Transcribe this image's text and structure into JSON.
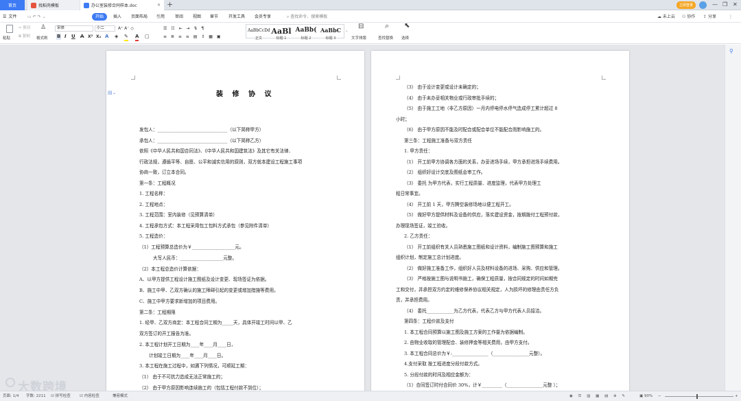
{
  "titlebar": {
    "home_tab": "首页",
    "tabs": [
      {
        "label": "找稻壳模板"
      },
      {
        "label": "办公室装修合同样本.doc"
      }
    ],
    "new_tab": "+",
    "user_button": "立即登录"
  },
  "menubar": {
    "file": "文件",
    "items": [
      "开始",
      "插入",
      "页面布局",
      "引用",
      "审阅",
      "视图",
      "章节",
      "开发工具",
      "会员专享"
    ],
    "active": "开始",
    "search_placeholder": "查找命令、搜索模板",
    "cloud": "未上云",
    "collab": "协作",
    "share": "分享"
  },
  "ribbon": {
    "paste": "粘贴",
    "cut": "剪切",
    "copy": "复制",
    "format_painter": "格式刷",
    "font_name": "宋体",
    "font_size": "小二",
    "styles": [
      {
        "preview": "AaBbCcDd",
        "label": "正文"
      },
      {
        "preview": "AaBl",
        "label": "标题 1"
      },
      {
        "preview": "AaBb(",
        "label": "标题 2"
      },
      {
        "preview": "AaBbC",
        "label": "标题 3"
      }
    ],
    "text_layout": "文字排版",
    "find_replace": "查找替换",
    "select": "选择"
  },
  "page1": {
    "title": "装 修 协 议",
    "lines": [
      "发包人：_______________________________（以下简称甲方）",
      "承包人：_______________________________（以下简称乙方）",
      "依照《中华人民共和国合同法》、《中华人民共和国建筑法》及其它有关法律、",
      "行政法规，遵循平等、自愿、公平和诚实信用的原则，双方就本建设工程施工事项",
      "协商一致，订立本合同。",
      "第一条：工程概况",
      "1. 工程名称：",
      "2. 工程地点：",
      "3. 工程范围：室内装修（见预算清单）",
      "4. 工程承包方式：本工程采用包工包料方式承包（参见附件清单）",
      "5. 工程造价：",
      "（1）工程预算总造价为￥___________________元。",
      "大写人民币：___________________元整。",
      "（2）本工程总造价计算依据：",
      "A、以甲方提供工程设计施工图纸及设计变更、现场签证为依据。",
      "B、施工中甲、乙双方确认的施工障碍引起的变更或增加措施等费用。",
      "C、施工中甲方要求新增加的项目费用。",
      "第二条：工程期限",
      "1. 经甲、乙双方商定：本工程合同工期为_____天，具体开竣工时间以甲、乙",
      "双方签订的开工报告为准。",
      "2. 本工程计划开工日期为____年____月____日，",
      "计划竣工日期为____年____月____日。",
      "3. 本工程在施工过程中，如遇下列情况，可顺延工期：",
      "（1） 由于不可抗力造成无法正常施工的；",
      "（2） 由于甲方原因影响连续施工的（包括工程付款不到位）；"
    ]
  },
  "page2": {
    "lines": [
      "（3） 由于设计变更或设计未确定的；",
      "（4） 由于未办妥相关物业或行政审批手续的；",
      "（5） 由于施工工地（非乙方原因）一月内停电停水停气造成停工累计超过 8",
      "小时；",
      "（6） 由于甲方原因不能及时配合或配合单位不能配合而影响施工的。",
      "第三条：工程施工准备与双方责任",
      "1. 甲方责任：",
      "（1） 开工前甲方协调各方面的关系，办妥进场手续，甲方承担进场手续费用。",
      "（2） 组织好设计交底及图纸会审工作。",
      "（3） 委托          为甲方代表，实行工程质量、进度监理，代表甲方处理工",
      "程日常事宜。",
      "（4） 开工前 1 天，甲方腾空装修场地以便工程开工。",
      "（5） 做好甲方提供材料及设备的供应，落实建设资金，按期拨付工程预付款，",
      "办理现场签证，竣工验收。",
      "2. 乙方责任：",
      "（1） 开工前组织有关人员熟悉施工图纸和设计资料，编制施工图预算和施工",
      "组织计划，制定施工总计划进度。",
      "（2） 做好施工准备工作，组织好人员及材料设备的进场、采购、供应和管理。",
      "（3） 严格按施工图与说明书施工，确保工程质量，按合同规定的时间如期完",
      "工和交付，并承担双方约定的维修保养协议相关规定，人为损坏的修理由责任方负",
      "责，并承担费用。",
      "（4） 委托____________为乙方代表，代表乙方与甲方代表人员接洽。",
      "第四条：工程价款及支付",
      "1. 本工程合同预算以施工图及施工方案的工作量为依据编制。",
      "2. 由物业收取的管理配合、装修押金等相关费用，由甲方支付。",
      "3. 本工程合同总价为￥:________________（________________元整）。",
      "4.支付采取  按工程进度分段付款方式。",
      "5. 分段付款的时间及相应金额为：",
      "（1）合同签订时付合同价 30%，计￥_________（________________元整  ）；"
    ]
  },
  "statusbar": {
    "page": "页面: 1/4",
    "words": "字数: 2211",
    "spell": "拼写检查",
    "content_check": "内容检查",
    "compat": "兼容模式",
    "zoom": "90%"
  },
  "watermark": "大数跨境"
}
